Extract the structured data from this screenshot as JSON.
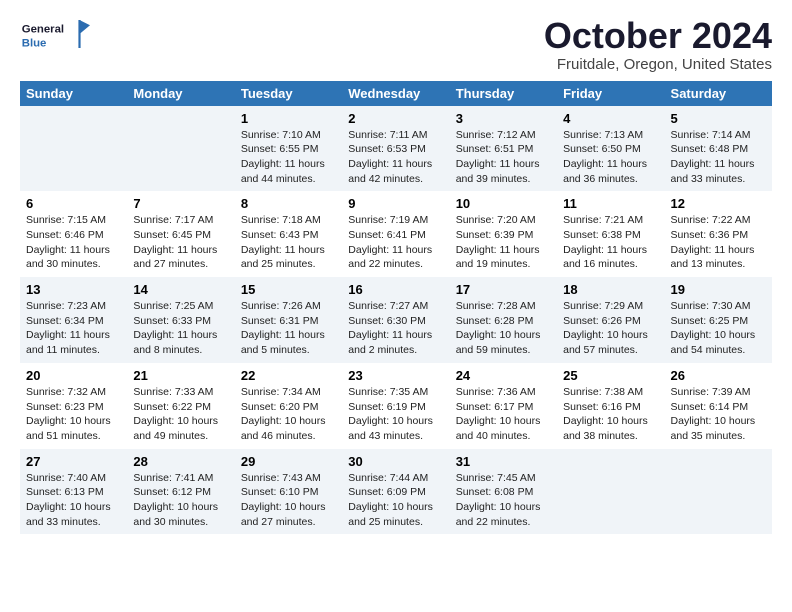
{
  "header": {
    "logo_general": "General",
    "logo_blue": "Blue",
    "month_title": "October 2024",
    "location": "Fruitdale, Oregon, United States"
  },
  "weekdays": [
    "Sunday",
    "Monday",
    "Tuesday",
    "Wednesday",
    "Thursday",
    "Friday",
    "Saturday"
  ],
  "weeks": [
    [
      {
        "day": "",
        "info": ""
      },
      {
        "day": "",
        "info": ""
      },
      {
        "day": "1",
        "info": "Sunrise: 7:10 AM\nSunset: 6:55 PM\nDaylight: 11 hours and 44 minutes."
      },
      {
        "day": "2",
        "info": "Sunrise: 7:11 AM\nSunset: 6:53 PM\nDaylight: 11 hours and 42 minutes."
      },
      {
        "day": "3",
        "info": "Sunrise: 7:12 AM\nSunset: 6:51 PM\nDaylight: 11 hours and 39 minutes."
      },
      {
        "day": "4",
        "info": "Sunrise: 7:13 AM\nSunset: 6:50 PM\nDaylight: 11 hours and 36 minutes."
      },
      {
        "day": "5",
        "info": "Sunrise: 7:14 AM\nSunset: 6:48 PM\nDaylight: 11 hours and 33 minutes."
      }
    ],
    [
      {
        "day": "6",
        "info": "Sunrise: 7:15 AM\nSunset: 6:46 PM\nDaylight: 11 hours and 30 minutes."
      },
      {
        "day": "7",
        "info": "Sunrise: 7:17 AM\nSunset: 6:45 PM\nDaylight: 11 hours and 27 minutes."
      },
      {
        "day": "8",
        "info": "Sunrise: 7:18 AM\nSunset: 6:43 PM\nDaylight: 11 hours and 25 minutes."
      },
      {
        "day": "9",
        "info": "Sunrise: 7:19 AM\nSunset: 6:41 PM\nDaylight: 11 hours and 22 minutes."
      },
      {
        "day": "10",
        "info": "Sunrise: 7:20 AM\nSunset: 6:39 PM\nDaylight: 11 hours and 19 minutes."
      },
      {
        "day": "11",
        "info": "Sunrise: 7:21 AM\nSunset: 6:38 PM\nDaylight: 11 hours and 16 minutes."
      },
      {
        "day": "12",
        "info": "Sunrise: 7:22 AM\nSunset: 6:36 PM\nDaylight: 11 hours and 13 minutes."
      }
    ],
    [
      {
        "day": "13",
        "info": "Sunrise: 7:23 AM\nSunset: 6:34 PM\nDaylight: 11 hours and 11 minutes."
      },
      {
        "day": "14",
        "info": "Sunrise: 7:25 AM\nSunset: 6:33 PM\nDaylight: 11 hours and 8 minutes."
      },
      {
        "day": "15",
        "info": "Sunrise: 7:26 AM\nSunset: 6:31 PM\nDaylight: 11 hours and 5 minutes."
      },
      {
        "day": "16",
        "info": "Sunrise: 7:27 AM\nSunset: 6:30 PM\nDaylight: 11 hours and 2 minutes."
      },
      {
        "day": "17",
        "info": "Sunrise: 7:28 AM\nSunset: 6:28 PM\nDaylight: 10 hours and 59 minutes."
      },
      {
        "day": "18",
        "info": "Sunrise: 7:29 AM\nSunset: 6:26 PM\nDaylight: 10 hours and 57 minutes."
      },
      {
        "day": "19",
        "info": "Sunrise: 7:30 AM\nSunset: 6:25 PM\nDaylight: 10 hours and 54 minutes."
      }
    ],
    [
      {
        "day": "20",
        "info": "Sunrise: 7:32 AM\nSunset: 6:23 PM\nDaylight: 10 hours and 51 minutes."
      },
      {
        "day": "21",
        "info": "Sunrise: 7:33 AM\nSunset: 6:22 PM\nDaylight: 10 hours and 49 minutes."
      },
      {
        "day": "22",
        "info": "Sunrise: 7:34 AM\nSunset: 6:20 PM\nDaylight: 10 hours and 46 minutes."
      },
      {
        "day": "23",
        "info": "Sunrise: 7:35 AM\nSunset: 6:19 PM\nDaylight: 10 hours and 43 minutes."
      },
      {
        "day": "24",
        "info": "Sunrise: 7:36 AM\nSunset: 6:17 PM\nDaylight: 10 hours and 40 minutes."
      },
      {
        "day": "25",
        "info": "Sunrise: 7:38 AM\nSunset: 6:16 PM\nDaylight: 10 hours and 38 minutes."
      },
      {
        "day": "26",
        "info": "Sunrise: 7:39 AM\nSunset: 6:14 PM\nDaylight: 10 hours and 35 minutes."
      }
    ],
    [
      {
        "day": "27",
        "info": "Sunrise: 7:40 AM\nSunset: 6:13 PM\nDaylight: 10 hours and 33 minutes."
      },
      {
        "day": "28",
        "info": "Sunrise: 7:41 AM\nSunset: 6:12 PM\nDaylight: 10 hours and 30 minutes."
      },
      {
        "day": "29",
        "info": "Sunrise: 7:43 AM\nSunset: 6:10 PM\nDaylight: 10 hours and 27 minutes."
      },
      {
        "day": "30",
        "info": "Sunrise: 7:44 AM\nSunset: 6:09 PM\nDaylight: 10 hours and 25 minutes."
      },
      {
        "day": "31",
        "info": "Sunrise: 7:45 AM\nSunset: 6:08 PM\nDaylight: 10 hours and 22 minutes."
      },
      {
        "day": "",
        "info": ""
      },
      {
        "day": "",
        "info": ""
      }
    ]
  ]
}
